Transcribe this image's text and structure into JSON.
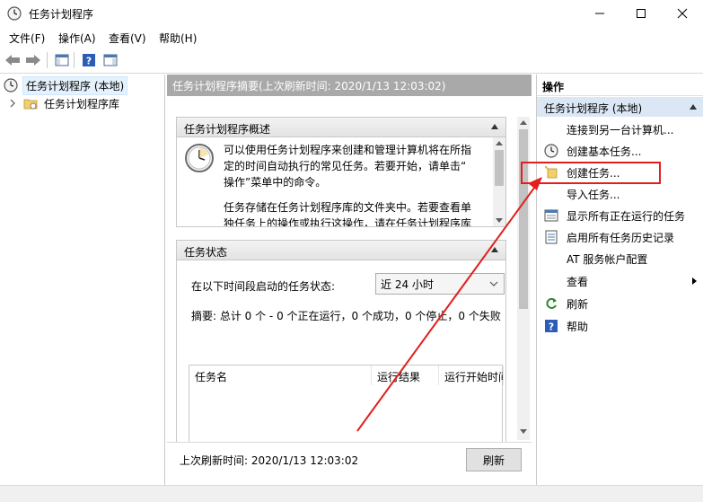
{
  "window": {
    "title": "任务计划程序"
  },
  "menu": [
    "文件(F)",
    "操作(A)",
    "查看(V)",
    "帮助(H)"
  ],
  "tree": {
    "root": "任务计划程序 (本地)",
    "child": "任务计划程序库"
  },
  "center": {
    "header": "任务计划程序摘要(上次刷新时间: 2020/1/13 12:03:02)",
    "overview": {
      "title": "任务计划程序概述",
      "p1_l1": "可以使用任务计划程序来创建和管理计算机将在所指",
      "p1_l2": "定的时间自动执行的常见任务。若要开始，请单击“",
      "p1_l3": "操作”菜单中的命令。",
      "p2_l1": "任务存储在任务计划程序库的文件夹中。若要查看单",
      "p2_l2": "独任务上的操作或执行这操作，请在任务计划程序库"
    },
    "status": {
      "title": "任务状态",
      "period_label": "在以下时间段启动的任务状态:",
      "period_value": "近 24 小时",
      "summary": "摘要: 总计 0 个 - 0 个正在运行，0 个成功，0 个停止，0 个失败",
      "columns": [
        "任务名",
        "运行结果",
        "运行开始时间"
      ]
    },
    "footer": {
      "last_refresh": "上次刷新时间: 2020/1/13 12:03:02",
      "refresh_button": "刷新"
    }
  },
  "actions": {
    "header": "操作",
    "group": "任务计划程序 (本地)",
    "items": [
      {
        "label": "连接到另一台计算机...",
        "icon": "none"
      },
      {
        "label": "创建基本任务...",
        "icon": "clock-icon"
      },
      {
        "label": "创建任务...",
        "icon": "new-task-icon"
      },
      {
        "label": "导入任务...",
        "icon": "none"
      },
      {
        "label": "显示所有正在运行的任务",
        "icon": "running-tasks-icon"
      },
      {
        "label": "启用所有任务历史记录",
        "icon": "history-icon"
      },
      {
        "label": "AT 服务帐户配置",
        "icon": "none"
      },
      {
        "label": "查看",
        "icon": "none"
      },
      {
        "label": "刷新",
        "icon": "refresh-icon"
      },
      {
        "label": "帮助",
        "icon": "help-icon"
      }
    ]
  },
  "colors": {
    "header_gray": "#a9a9a9",
    "selection": "#e5f1fb",
    "action_group_bg": "#dbe7f4",
    "annotation_red": "#e02020"
  }
}
